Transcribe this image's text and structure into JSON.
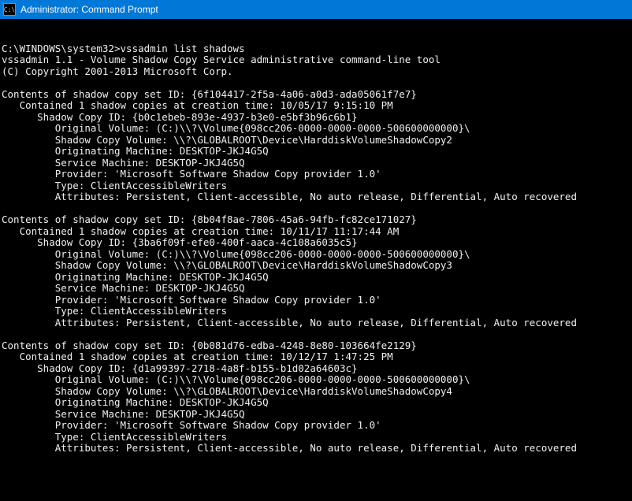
{
  "titlebar": {
    "icon_label": "C:\\",
    "title": "Administrator: Command Prompt"
  },
  "prompt": {
    "path": "C:\\WINDOWS\\system32>",
    "command": "vssadmin list shadows"
  },
  "header": {
    "line1": "vssadmin 1.1 - Volume Shadow Copy Service administrative command-line tool",
    "line2": "(C) Copyright 2001-2013 Microsoft Corp."
  },
  "sets": [
    {
      "set_id": "{6f104417-2f5a-4a06-a0d3-ada05061f7e7}",
      "contained": "Contained 1 shadow copies at creation time: 10/05/17 9:15:10 PM",
      "copy_id": "{b0c1ebeb-893e-4937-b3e0-e5bf3b96c6b1}",
      "original_volume": "(C:)\\\\?\\Volume{098cc206-0000-0000-0000-500600000000}\\",
      "shadow_copy_volume": "\\\\?\\GLOBALROOT\\Device\\HarddiskVolumeShadowCopy2",
      "originating_machine": "DESKTOP-JKJ4G5Q",
      "service_machine": "DESKTOP-JKJ4G5Q",
      "provider": "'Microsoft Software Shadow Copy provider 1.0'",
      "type": "ClientAccessibleWriters",
      "attributes": "Persistent, Client-accessible, No auto release, Differential, Auto recovered"
    },
    {
      "set_id": "{8b04f8ae-7806-45a6-94fb-fc82ce171027}",
      "contained": "Contained 1 shadow copies at creation time: 10/11/17 11:17:44 AM",
      "copy_id": "{3ba6f09f-efe0-400f-aaca-4c108a6035c5}",
      "original_volume": "(C:)\\\\?\\Volume{098cc206-0000-0000-0000-500600000000}\\",
      "shadow_copy_volume": "\\\\?\\GLOBALROOT\\Device\\HarddiskVolumeShadowCopy3",
      "originating_machine": "DESKTOP-JKJ4G5Q",
      "service_machine": "DESKTOP-JKJ4G5Q",
      "provider": "'Microsoft Software Shadow Copy provider 1.0'",
      "type": "ClientAccessibleWriters",
      "attributes": "Persistent, Client-accessible, No auto release, Differential, Auto recovered"
    },
    {
      "set_id": "{0b081d76-edba-4248-8e80-103664fe2129}",
      "contained": "Contained 1 shadow copies at creation time: 10/12/17 1:47:25 PM",
      "copy_id": "{d1a99397-2718-4a8f-b155-b1d02a64603c}",
      "original_volume": "(C:)\\\\?\\Volume{098cc206-0000-0000-0000-500600000000}\\",
      "shadow_copy_volume": "\\\\?\\GLOBALROOT\\Device\\HarddiskVolumeShadowCopy4",
      "originating_machine": "DESKTOP-JKJ4G5Q",
      "service_machine": "DESKTOP-JKJ4G5Q",
      "provider": "'Microsoft Software Shadow Copy provider 1.0'",
      "type": "ClientAccessibleWriters",
      "attributes": "Persistent, Client-accessible, No auto release, Differential, Auto recovered"
    }
  ],
  "labels": {
    "contents": "Contents of shadow copy set ID: ",
    "shadow_copy_id": "Shadow Copy ID: ",
    "original_volume": "Original Volume: ",
    "shadow_copy_volume": "Shadow Copy Volume: ",
    "originating_machine": "Originating Machine: ",
    "service_machine": "Service Machine: ",
    "provider": "Provider: ",
    "type": "Type: ",
    "attributes": "Attributes: "
  },
  "indent": {
    "l1": "   ",
    "l2": "      ",
    "l3": "         "
  }
}
